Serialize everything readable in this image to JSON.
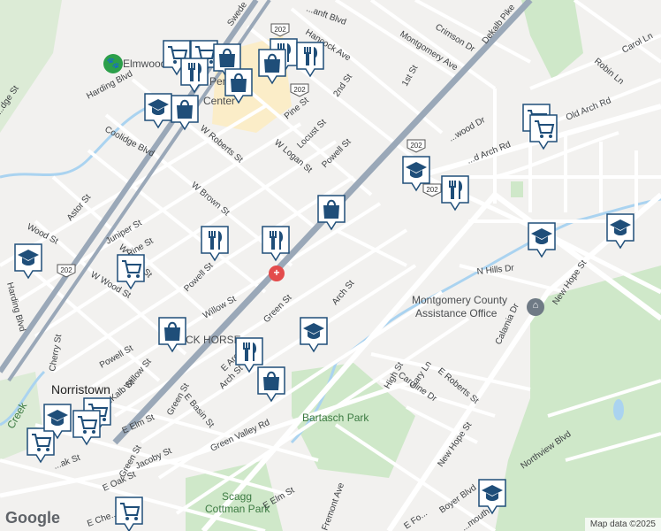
{
  "map": {
    "places": {
      "zoo": "Elmwood Park Zoo",
      "mall": "PennDu",
      "mall_tail": "Center",
      "assistance_1": "Montgomery County",
      "assistance_2": "Assistance Office",
      "town": "Norristown",
      "park1": "Bartasch Park",
      "park2a": "Scagg",
      "park2b": "Cottman Park",
      "black_horse": "CK HORSE"
    },
    "streets": {
      "harding_blvd": "Harding Blvd",
      "coolidge_blvd": "Coolidge Blvd",
      "astor_st": "Astor St",
      "wood_st": "Wood St",
      "juniper_st": "Juniper St",
      "pine_st_w": "Pine St",
      "w_wood_st": "W Wood St",
      "w_freedley_st": "W F...ce St",
      "powell_st": "Powell St",
      "willow_st": "Willow St",
      "w_roberts_st": "W Roberts St",
      "w_brown_st": "W Brown St",
      "w_logan_st": "W Logan St",
      "locust_st": "Locust St",
      "pine_st": "Pine St",
      "powell_st_2": "Powell St",
      "second_st": "2nd St",
      "first_st": "1st St",
      "hancock_ave": "Hancock Ave",
      "montgomery_ave": "Montgomery Ave",
      "crimson_dr": "Crimson Dr",
      "dekalb_pike": "Dekalb Pike",
      "carol_ln": "Carol Ln",
      "robin_ln": "Robin Ln",
      "old_arch_rd": "Old Arch Rd",
      "old_arch_rd_2": "...d Arch Rd",
      "wood_dr": "...wood Dr",
      "n_hills_dr": "N Hills Dr",
      "new_hope_st": "New Hope St",
      "new_hope_st_2": "New Hope St",
      "arch_st": "Arch St",
      "arch_st_2": "Arch St",
      "green_st": "Green St",
      "green_st_2": "Green St",
      "green_st_3": "Green St",
      "e_basin_st": "E Basin St",
      "green_valley_rd": "Green Valley Rd",
      "high_st": "High St",
      "e_roberts_st": "E Roberts St",
      "gary_ln": "Gary Ln",
      "caroline_dr": "Caroline Dr",
      "calamia_dr": "Calamia Dr",
      "northview_blvd": "Northview Blvd",
      "boyer_blvd": "Boyer Blvd",
      "e_elm_st": "E Elm St",
      "e_elm_st_2": "E Elm St",
      "e_oak_st": "E Oak St",
      "jacoby_st": "Jacoby St",
      "cherry_st": "Cherry St",
      "powell_st_3": "Powell St",
      "willow_st_2": "Willow St",
      "dekalb_st": "DeKalb St",
      "fremont_ave": "Fremont Ave",
      "harding_blvd_2": "Harding Blvd",
      "swede": "Swede",
      "danft": "...anft Blvd",
      "dge_st": "...dge St",
      "oak_st": "...ak St",
      "e_ch": "E Che...",
      "e_fo": "E Fo...",
      "mouth": "...mouth",
      "e_arch": "E Arch..."
    },
    "shields": {
      "r202_a": "202",
      "r202_b": "202",
      "r202_c": "202",
      "r202_d": "202",
      "r202_e": "202"
    },
    "creek": "Creek",
    "attribution": "Map data ©2025",
    "logo": "Google"
  },
  "colors": {
    "land": "#f2f1ef",
    "park": "#cfe8c9",
    "water": "#aad3f0",
    "highway": "#9aa8b8",
    "road": "#ffffff",
    "marker": "#1f4e79",
    "mall": "#fbedc8"
  },
  "markers": [
    {
      "icon": "cart-icon"
    },
    {
      "icon": "utensils-icon"
    },
    {
      "icon": "bag-icon"
    },
    {
      "icon": "graduation-cap-icon"
    }
  ]
}
